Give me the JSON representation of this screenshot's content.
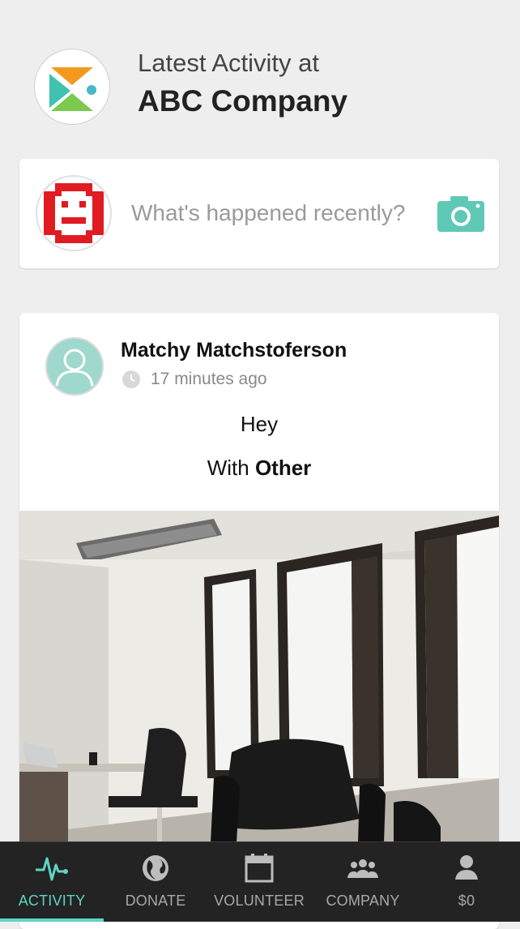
{
  "header": {
    "subtitle": "Latest Activity at",
    "company_name": "ABC Company",
    "logo_icon": "abc-company-logo"
  },
  "composer": {
    "placeholder": "What's happened recently?",
    "avatar_icon": "robot-avatar",
    "camera_icon": "camera-icon",
    "accent_color": "#5fc9b6"
  },
  "feed": {
    "posts": [
      {
        "author": "Matchy Matchstoferson",
        "time_ago": "17 minutes ago",
        "text": "Hey",
        "with_prefix": "With",
        "with_name": "Other"
      }
    ]
  },
  "tabbar": {
    "active_color": "#5fd4c4",
    "tabs": [
      {
        "label": "ACTIVITY",
        "icon": "activity-pulse-icon"
      },
      {
        "label": "DONATE",
        "icon": "globe-icon"
      },
      {
        "label": "VOLUNTEER",
        "icon": "calendar-icon"
      },
      {
        "label": "COMPANY",
        "icon": "group-icon"
      },
      {
        "label": "$0",
        "icon": "user-icon"
      }
    ]
  }
}
